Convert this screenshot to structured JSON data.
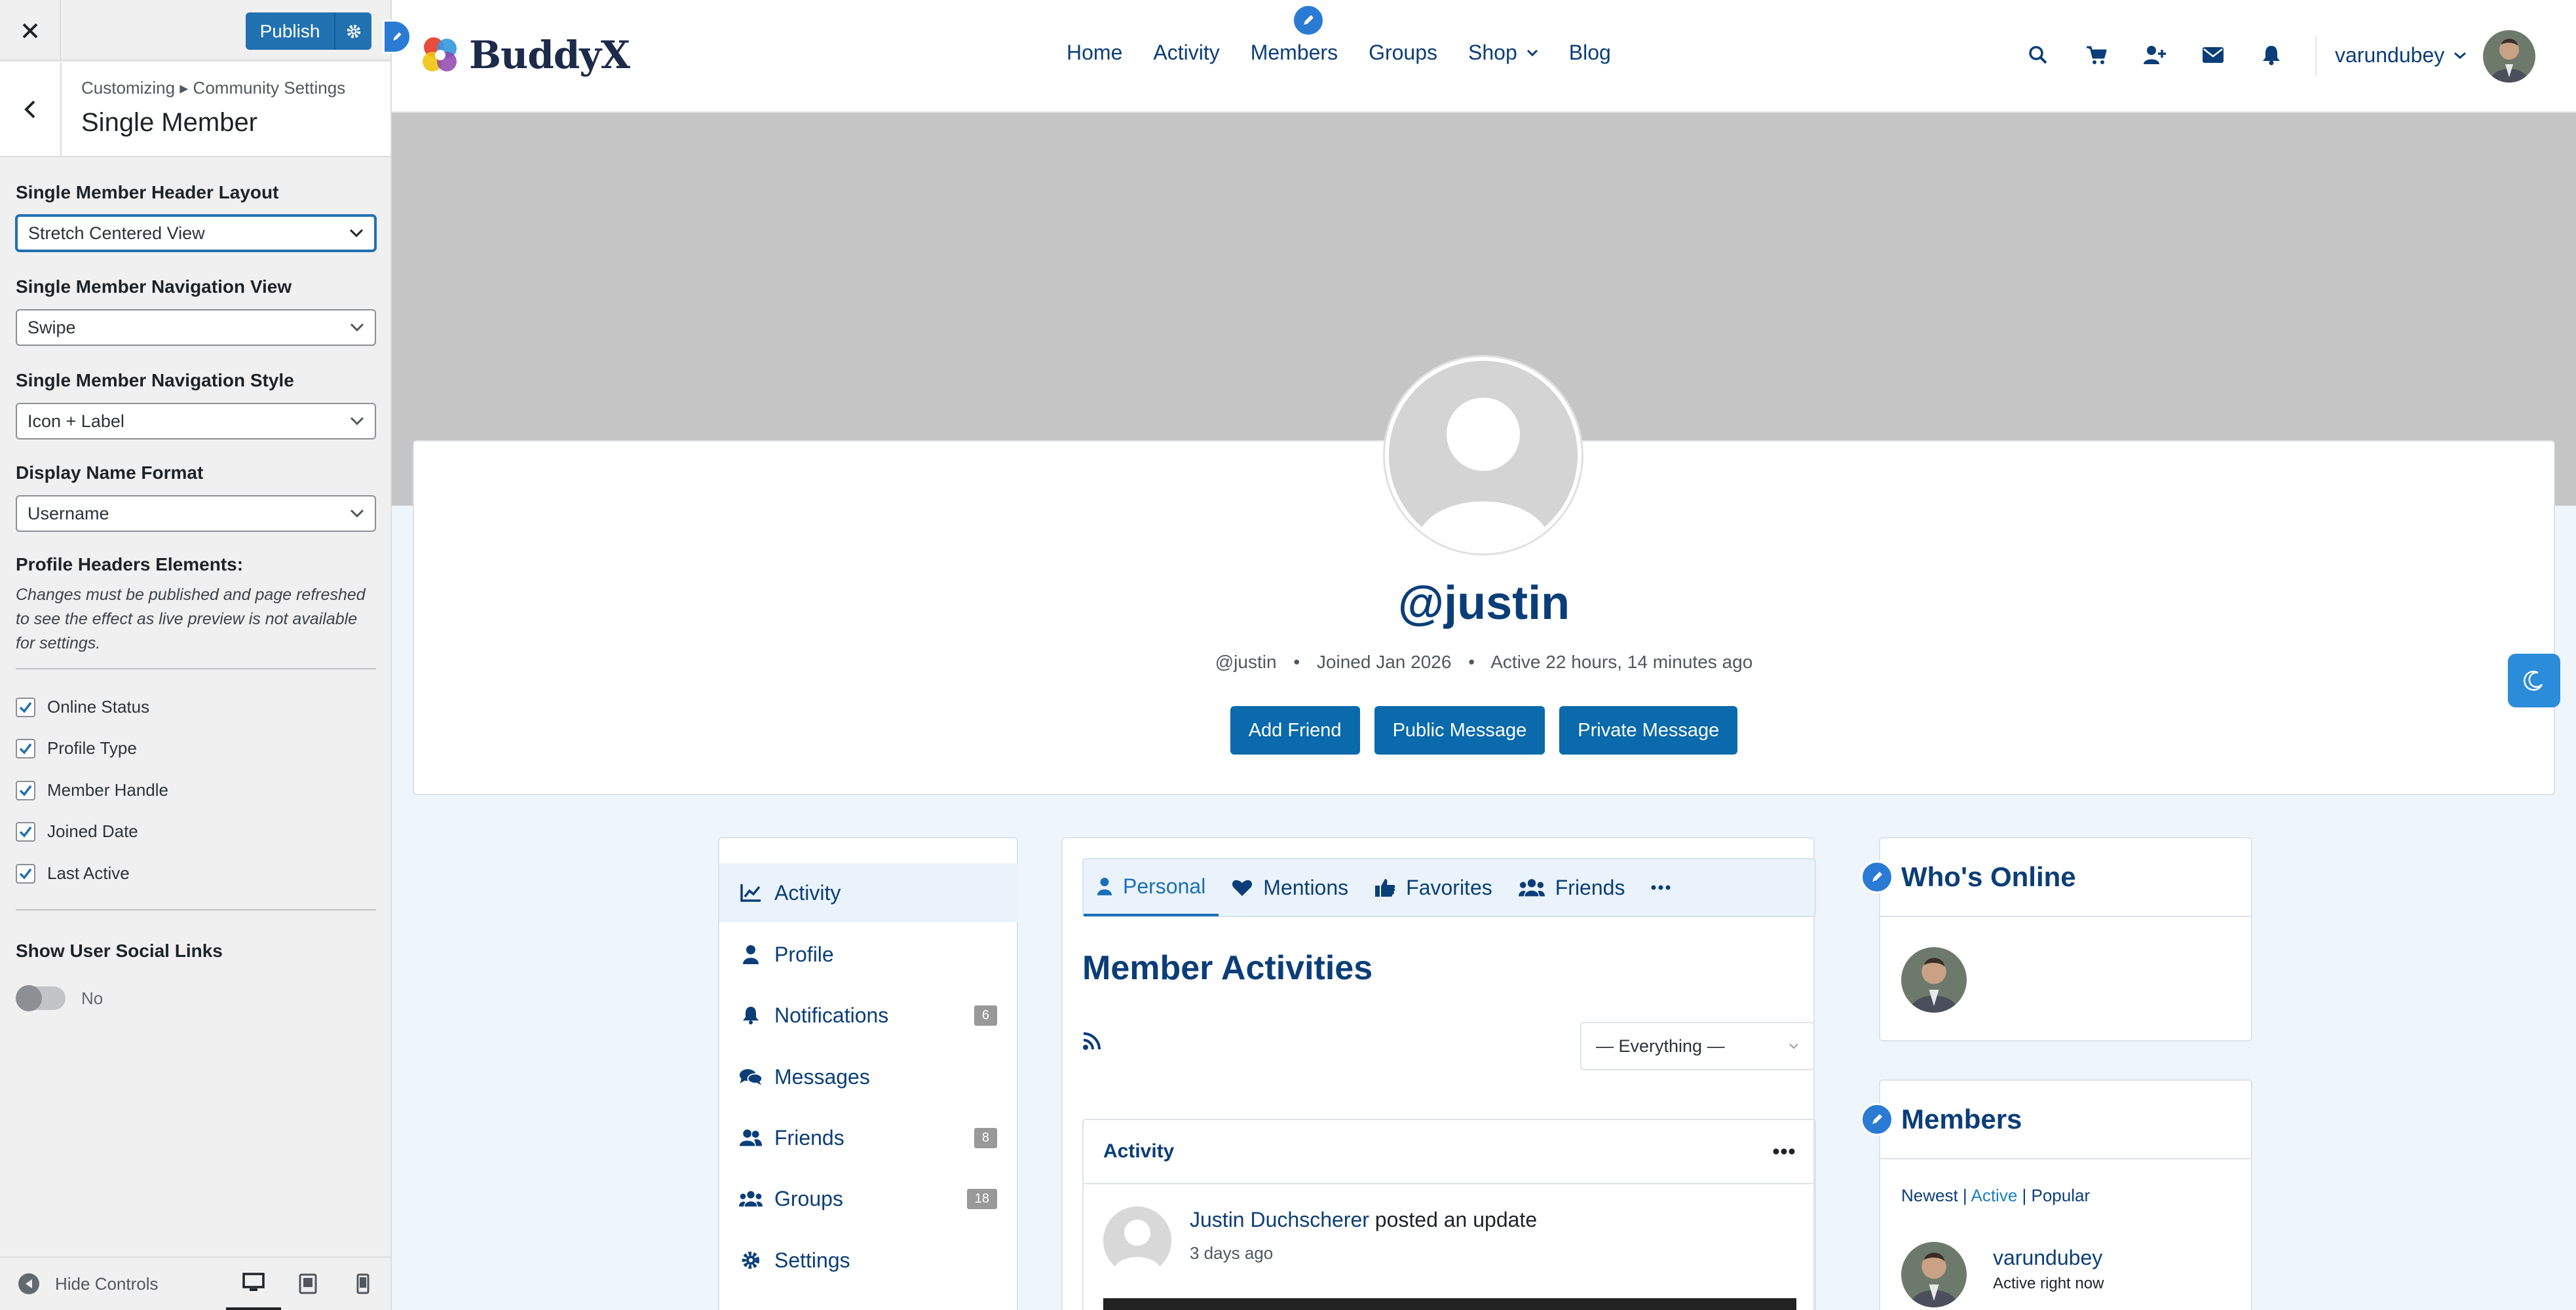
{
  "customizer": {
    "publish_label": "Publish",
    "breadcrumb": "Customizing ▸ Community Settings",
    "section_title": "Single Member",
    "fields": {
      "header_layout": {
        "label": "Single Member Header Layout",
        "value": "Stretch Centered View"
      },
      "nav_view": {
        "label": "Single Member Navigation View",
        "value": "Swipe"
      },
      "nav_style": {
        "label": "Single Member Navigation Style",
        "value": "Icon + Label"
      },
      "display_name": {
        "label": "Display Name Format",
        "value": "Username"
      }
    },
    "header_elements": {
      "label": "Profile Headers Elements:",
      "note": "Changes must be published and page refreshed to see the effect as live preview is not available for settings.",
      "checks": [
        "Online Status",
        "Profile Type",
        "Member Handle",
        "Joined Date",
        "Last Active"
      ]
    },
    "social_links": {
      "label": "Show User Social Links",
      "toggle_text": "No"
    },
    "hide_controls": "Hide Controls"
  },
  "site": {
    "logo_text": "BuddyX",
    "nav": [
      "Home",
      "Activity",
      "Members",
      "Groups",
      "Shop",
      "Blog"
    ],
    "username": "varundubey"
  },
  "profile": {
    "name": "@justin",
    "handle": "@justin",
    "joined": "Joined Jan 2026",
    "active": "Active 22 hours, 14 minutes ago",
    "buttons": {
      "add_friend": "Add Friend",
      "public_message": "Public Message",
      "private_message": "Private Message"
    }
  },
  "member_nav": [
    {
      "label": "Activity",
      "badge": ""
    },
    {
      "label": "Profile",
      "badge": ""
    },
    {
      "label": "Notifications",
      "badge": "6"
    },
    {
      "label": "Messages",
      "badge": ""
    },
    {
      "label": "Friends",
      "badge": "8"
    },
    {
      "label": "Groups",
      "badge": "18"
    },
    {
      "label": "Settings",
      "badge": ""
    }
  ],
  "content": {
    "subnav": [
      "Personal",
      "Mentions",
      "Favorites",
      "Friends"
    ],
    "title": "Member Activities",
    "filter": "— Everything —",
    "activity_box_title": "Activity",
    "activity": {
      "author": "Justin Duchscherer",
      "action": "posted an update",
      "time": "3 days ago"
    }
  },
  "widgets": {
    "whos_online": {
      "title": "Who's Online"
    },
    "members": {
      "title": "Members",
      "tabs": {
        "newest": "Newest",
        "active": "Active",
        "popular": "Popular"
      },
      "member_name": "varundubey",
      "member_status": "Active right now"
    }
  },
  "colors": {
    "accent": "#0a6aab",
    "heading": "#0b3e78",
    "customizer_blue": "#2271b1"
  }
}
